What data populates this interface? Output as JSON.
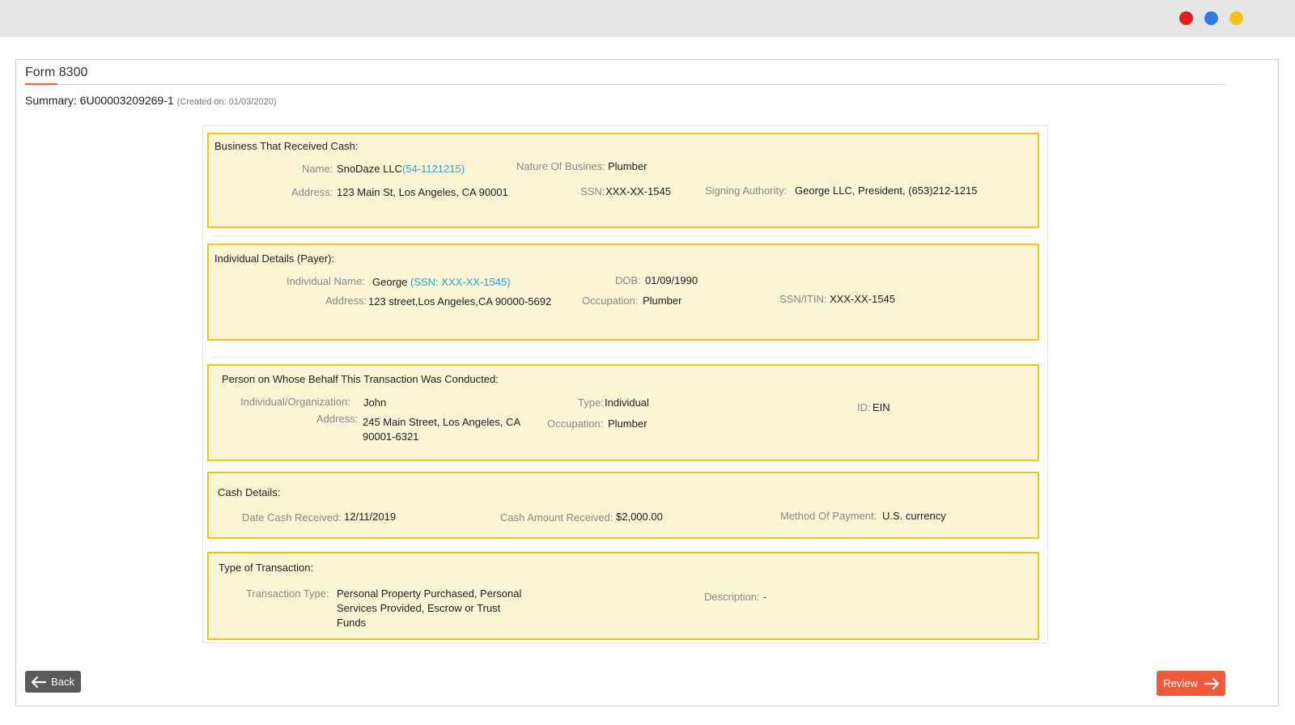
{
  "window": {
    "controls": [
      {
        "name": "close",
        "color": "#e02020"
      },
      {
        "name": "maximize",
        "color": "#2e7be6"
      },
      {
        "name": "minimize",
        "color": "#f0c419"
      }
    ]
  },
  "header": {
    "title": "Form 8300",
    "summary_label": "Summary: 6U00003209269-1",
    "created": "(Created on: 01/03/2020)"
  },
  "business": {
    "title": "Business That Received Cash:",
    "name_label": "Name:",
    "name_value": "SnoDaze LLC",
    "name_link": "(54-1121215)",
    "nature_label": "Nature Of Busines:",
    "nature_value": "Plumber",
    "address_label": "Address:",
    "address_value": "123 Main St, Los Angeles, CA 90001",
    "ssn_label": "SSN:",
    "ssn_value": "XXX-XX-1545",
    "signing_label": "Signing Authority:",
    "signing_value": "George LLC, President, (653)212-1215"
  },
  "individual": {
    "title": "Individual Details (Payer):",
    "name_label": "Individual Name:",
    "name_value": "George",
    "name_link": "(SSN: XXX-XX-1545)",
    "dob_label": "DOB:",
    "dob_value": "01/09/1990",
    "address_label": "Address:",
    "address_value": "123 street,Los Angeles,CA 90000-5692",
    "occupation_label": "Occupation:",
    "occupation_value": "Plumber",
    "ssn_label": "SSN/ITIN:",
    "ssn_value": "XXX-XX-1545"
  },
  "behalf": {
    "title": "Person on Whose Behalf This Transaction Was Conducted:",
    "org_label": "Individual/Organization:",
    "org_value": "John",
    "type_label": "Type:",
    "type_value": "Individual",
    "id_label": "ID:",
    "id_value": "EIN",
    "address_label": "Address:",
    "address_value": "245 Main Street, Los Angeles, CA 90001-6321",
    "occupation_label": "Occupation:",
    "occupation_value": "Plumber"
  },
  "cash": {
    "title": "Cash Details:",
    "date_label": "Date Cash Received:",
    "date_value": "12/11/2019",
    "amount_label": "Cash Amount Received:",
    "amount_value": "$2,000.00",
    "method_label": "Method Of Payment:",
    "method_value": "U.S. currency"
  },
  "transaction": {
    "title": "Type of Transaction:",
    "type_label": "Transaction Type:",
    "type_value": "Personal Property Purchased, Personal Services Provided, Escrow or Trust Funds",
    "description_label": "Description:",
    "description_value": "-"
  },
  "footer": {
    "back_label": "Back",
    "review_label": "Review"
  },
  "colors": {
    "accent": "#ee5a3a",
    "section_border": "#f0c419",
    "section_bg": "#fbf5d6",
    "link": "#2ba3d8"
  }
}
